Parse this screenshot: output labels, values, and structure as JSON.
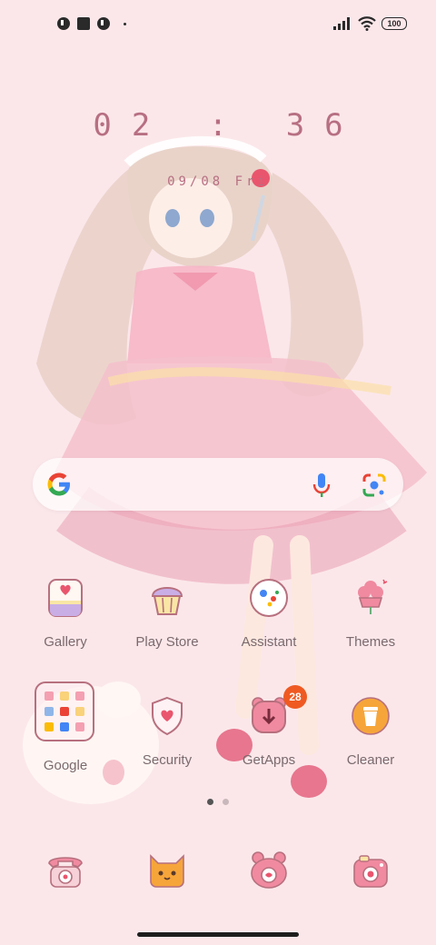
{
  "status_bar": {
    "battery": "100",
    "left_icons": [
      "notification-icon",
      "app-square-icon",
      "notification-icon"
    ],
    "right_icons": [
      "signal-icon",
      "wifi-icon",
      "battery-icon"
    ]
  },
  "lockscreen": {
    "time": "02 : 36",
    "date": "09/08 Fri"
  },
  "search": {
    "icons": [
      "google-icon",
      "microphone-icon",
      "google-lens-icon"
    ]
  },
  "apps": [
    {
      "label": "Gallery",
      "icon": "gallery-icon"
    },
    {
      "label": "Play Store",
      "icon": "cupcake-icon"
    },
    {
      "label": "Assistant",
      "icon": "assistant-icon"
    },
    {
      "label": "Themes",
      "icon": "flower-pot-icon"
    },
    {
      "label": "Google",
      "icon": "folder-icon"
    },
    {
      "label": "Security",
      "icon": "shield-heart-icon"
    },
    {
      "label": "GetApps",
      "icon": "bear-download-icon",
      "badge": "28"
    },
    {
      "label": "Cleaner",
      "icon": "trash-can-icon"
    }
  ],
  "dock": [
    {
      "icon": "phone-icon"
    },
    {
      "icon": "cat-messages-icon"
    },
    {
      "icon": "bear-browser-icon"
    },
    {
      "icon": "camera-icon"
    }
  ],
  "colors": {
    "background": "#fbe7ea",
    "accent": "#b76f82",
    "badge": "#ef5a22"
  }
}
